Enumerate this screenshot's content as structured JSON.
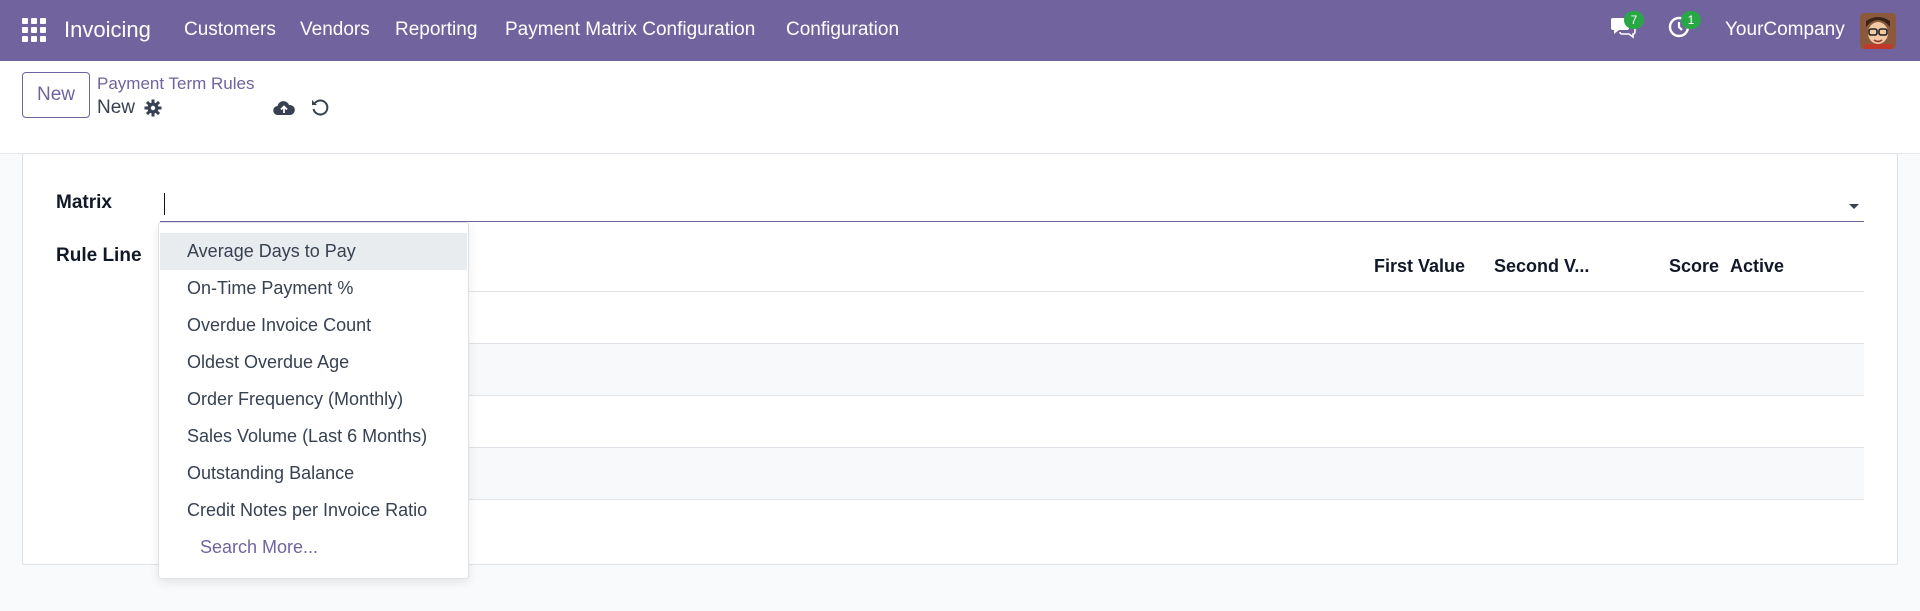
{
  "navbar": {
    "app_name": "Invoicing",
    "menu": [
      "Customers",
      "Vendors",
      "Reporting",
      "Payment Matrix Configuration",
      "Configuration"
    ],
    "messages_count": "7",
    "activities_count": "1",
    "company": "YourCompany",
    "accent_color": "#71639e",
    "badge_color": "#28a745"
  },
  "control_panel": {
    "new_button": "New",
    "breadcrumb_parent": "Payment Term Rules",
    "breadcrumb_current": "New"
  },
  "form": {
    "matrix_label": "Matrix",
    "matrix_value": "",
    "rule_line_label": "Rule Line",
    "columns": [
      "First Value",
      "Second V...",
      "Score",
      "Active"
    ]
  },
  "autocomplete": {
    "options": [
      "Average Days to Pay",
      "On-Time Payment %",
      "Overdue Invoice Count",
      "Oldest Overdue Age",
      "Order Frequency (Monthly)",
      "Sales Volume (Last 6 Months)",
      "Outstanding Balance",
      "Credit Notes per Invoice Ratio"
    ],
    "search_more": "Search More...",
    "highlighted_index": 0
  }
}
